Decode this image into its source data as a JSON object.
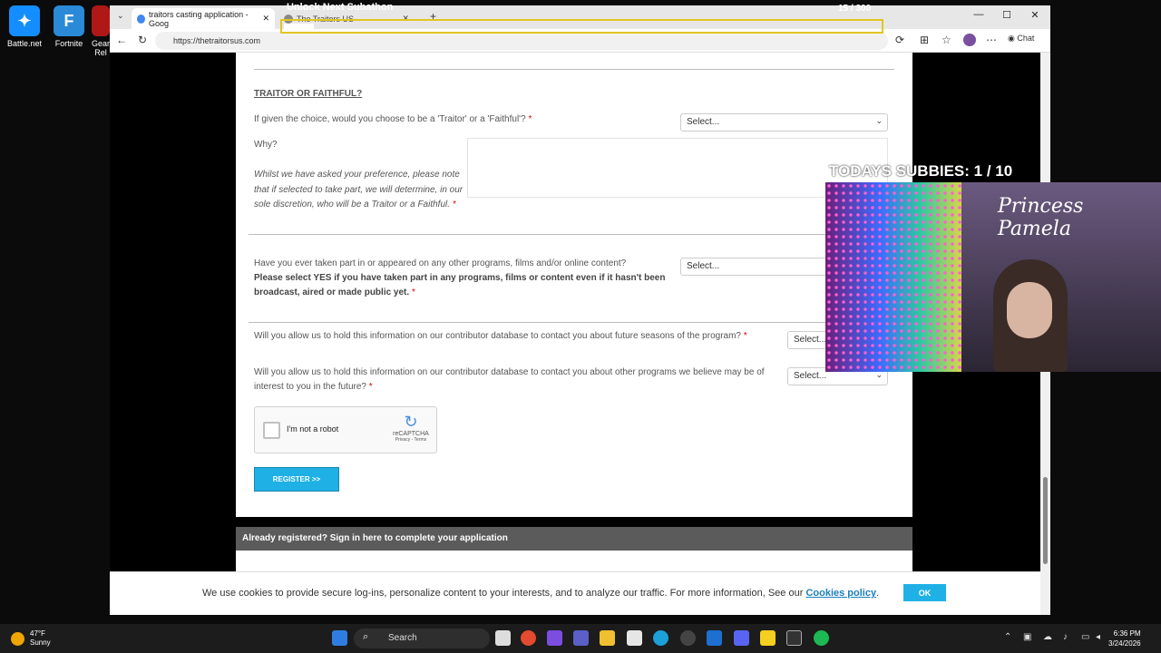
{
  "desktop": {
    "icons": [
      {
        "label": "Battle.net"
      },
      {
        "label": "Fortnite"
      },
      {
        "label": "Gear"
      },
      {
        "label": "Rel"
      }
    ]
  },
  "browser": {
    "tab_title": "traitors casting application - Goog",
    "second_tab_title": "The Traitors US",
    "url": "https://thetraitorsus.com",
    "chat_label": "Chat"
  },
  "form": {
    "section_title": "TRAITOR OR FAITHFUL?",
    "q1": "If given the choice, would you choose to be a 'Traitor' or a 'Faithful'?",
    "q1_select": "Select...",
    "why_label": "Why?",
    "why_note": "Whilst we have asked your preference, please note that if selected to take part, we will determine, in our sole discretion, who will be a Traitor or a Faithful.",
    "q2": "Have you ever taken part in or appeared on any other programs, films and/or online content?",
    "q2_bold": "Please select YES if you have taken part in any programs, films or content even if it hasn't been broadcast, aired or made public yet.",
    "q2_select": "Select...",
    "q3": "Will you allow us to hold this information on our contributor database to contact you about future seasons of the program?",
    "q3_select": "Select...",
    "q4": "Will you allow us to hold this information on our contributor database to contact you about other programs we believe may be of interest to you in the future?",
    "q4_select": "Select...",
    "required_mark": "*",
    "captcha_label": "I'm not a robot",
    "captcha_brand": "reCAPTCHA",
    "captcha_links": "Privacy - Terms",
    "register_label": "REGISTER >>",
    "signin_bar": "Already registered? Sign in here to complete your application"
  },
  "cookie": {
    "text": "We use cookies to provide secure log-ins, personalize content to your interests, and to analyze our traffic. For more information, See our",
    "link": "Cookies policy",
    "period": ".",
    "ok": "OK"
  },
  "overlay": {
    "title": "Unlock Next Subathon",
    "count": "15 / 300",
    "progress": 0.05,
    "subbies": "TODAYS SUBBIES:  1 / 10",
    "cam_name": "Princess Pamela"
  },
  "taskbar": {
    "temp": "47°F",
    "condition": "Sunny",
    "search": "Search",
    "time": "6:36 PM",
    "date": "3/24/2026"
  }
}
